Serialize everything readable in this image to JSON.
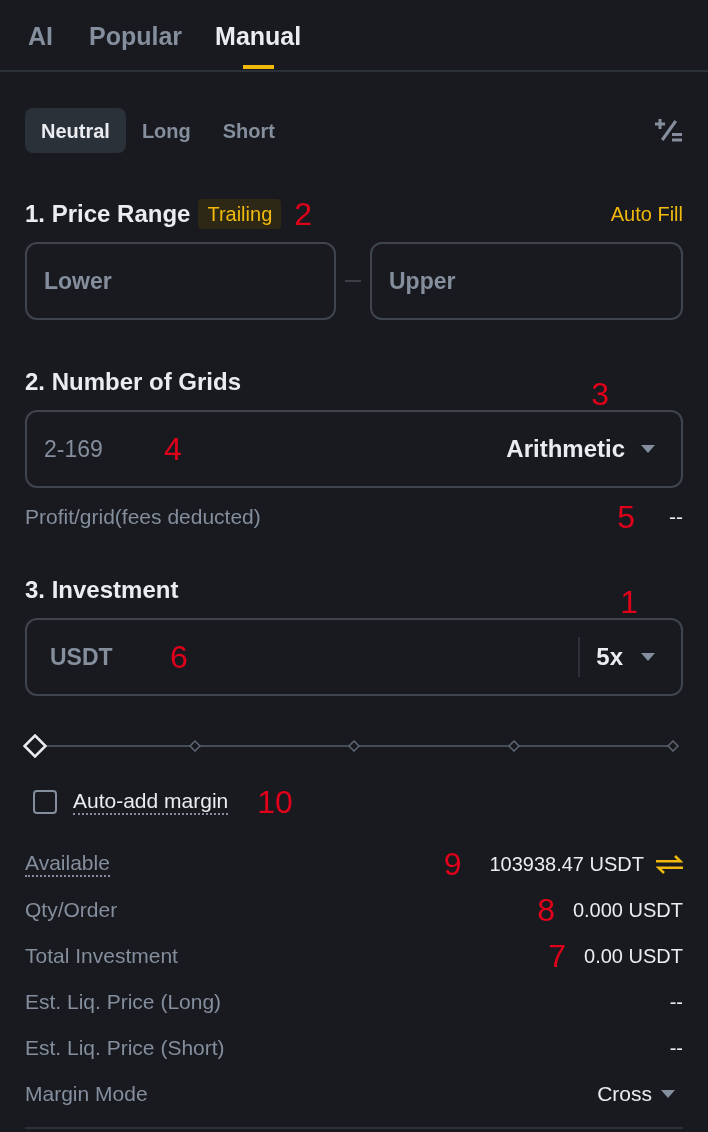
{
  "tabs": [
    {
      "label": "AI",
      "selected": false
    },
    {
      "label": "Popular",
      "selected": false
    },
    {
      "label": "Manual",
      "selected": true
    }
  ],
  "direction_tabs": [
    {
      "label": "Neutral",
      "selected": true
    },
    {
      "label": "Long",
      "selected": false
    },
    {
      "label": "Short",
      "selected": false
    }
  ],
  "price_range": {
    "title": "1. Price Range",
    "tag": "Trailing",
    "callout": "2",
    "action": "Auto Fill",
    "lower": {
      "placeholder": "Lower"
    },
    "upper": {
      "placeholder": "Upper"
    }
  },
  "grids": {
    "title": "2. Number of Grids",
    "count": {
      "placeholder": "2-169",
      "callout": "4"
    },
    "type": {
      "value": "Arithmetic",
      "callout": "3"
    },
    "profit": {
      "label": "Profit/grid(fees deducted)",
      "value": "--",
      "callout": "5"
    }
  },
  "investment": {
    "title": "3. Investment",
    "amount": {
      "placeholder": "USDT",
      "callout": "6"
    },
    "leverage": {
      "value": "5x",
      "callout": "1"
    },
    "slider": {
      "level": 0
    },
    "auto_add_margin": {
      "label": "Auto-add margin",
      "checked": false,
      "callout": "10"
    }
  },
  "summary": [
    {
      "kind": "balance",
      "label": "Available",
      "value": "103938.47 USDT",
      "callout": "9"
    },
    {
      "kind": "plain",
      "label": "Qty/Order",
      "value": "0.000 USDT",
      "callout": "8"
    },
    {
      "kind": "plain",
      "label": "Total Investment",
      "value": "0.00 USDT",
      "callout": "7"
    },
    {
      "kind": "plain",
      "label": "Est. Liq. Price (Long)",
      "value": "--"
    },
    {
      "kind": "plain",
      "label": "Est. Liq. Price (Short)",
      "value": "--"
    },
    {
      "kind": "select",
      "label": "Margin Mode",
      "value": "Cross"
    }
  ]
}
